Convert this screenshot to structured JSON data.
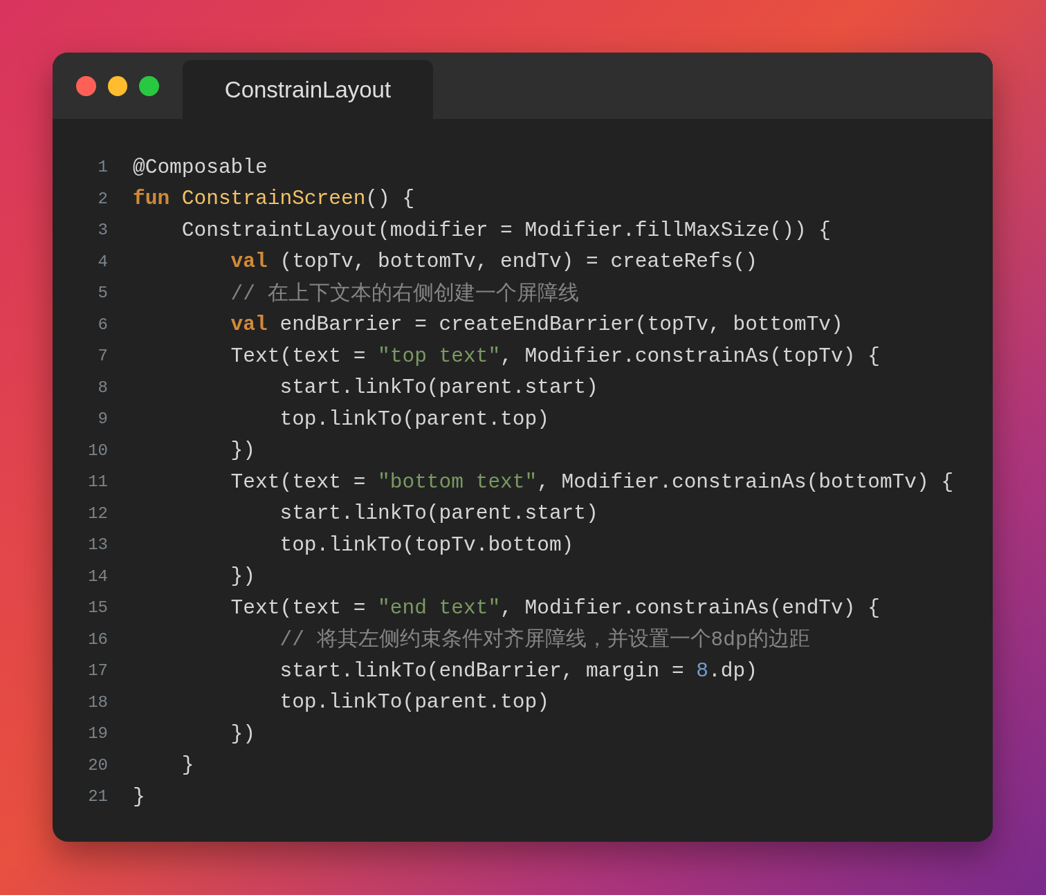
{
  "window": {
    "title": "ConstrainLayout"
  },
  "code": {
    "lines": [
      {
        "number": "1",
        "tokens": [
          {
            "kind": "plain",
            "text": "@Composable"
          }
        ]
      },
      {
        "number": "2",
        "tokens": [
          {
            "kind": "keyword",
            "text": "fun "
          },
          {
            "kind": "function",
            "text": "ConstrainScreen"
          },
          {
            "kind": "plain",
            "text": "() {"
          }
        ]
      },
      {
        "number": "3",
        "tokens": [
          {
            "kind": "plain",
            "text": "    ConstraintLayout(modifier = Modifier.fillMaxSize()) {"
          }
        ]
      },
      {
        "number": "4",
        "tokens": [
          {
            "kind": "keyword",
            "text": "        val"
          },
          {
            "kind": "plain",
            "text": " (topTv, bottomTv, endTv) = createRefs()"
          }
        ]
      },
      {
        "number": "5",
        "tokens": [
          {
            "kind": "comment",
            "text": "        // 在上下文本的右侧创建一个屏障线"
          }
        ]
      },
      {
        "number": "6",
        "tokens": [
          {
            "kind": "keyword",
            "text": "        val"
          },
          {
            "kind": "plain",
            "text": " endBarrier = createEndBarrier(topTv, bottomTv)"
          }
        ]
      },
      {
        "number": "7",
        "tokens": [
          {
            "kind": "plain",
            "text": "        Text(text = "
          },
          {
            "kind": "string",
            "text": "\"top text\""
          },
          {
            "kind": "plain",
            "text": ", Modifier.constrainAs(topTv) {"
          }
        ]
      },
      {
        "number": "8",
        "tokens": [
          {
            "kind": "plain",
            "text": "            start.linkTo(parent.start)"
          }
        ]
      },
      {
        "number": "9",
        "tokens": [
          {
            "kind": "plain",
            "text": "            top.linkTo(parent.top)"
          }
        ]
      },
      {
        "number": "10",
        "tokens": [
          {
            "kind": "plain",
            "text": "        })"
          }
        ]
      },
      {
        "number": "11",
        "tokens": [
          {
            "kind": "plain",
            "text": "        Text(text = "
          },
          {
            "kind": "string",
            "text": "\"bottom text\""
          },
          {
            "kind": "plain",
            "text": ", Modifier.constrainAs(bottomTv) {"
          }
        ]
      },
      {
        "number": "12",
        "tokens": [
          {
            "kind": "plain",
            "text": "            start.linkTo(parent.start)"
          }
        ]
      },
      {
        "number": "13",
        "tokens": [
          {
            "kind": "plain",
            "text": "            top.linkTo(topTv.bottom)"
          }
        ]
      },
      {
        "number": "14",
        "tokens": [
          {
            "kind": "plain",
            "text": "        })"
          }
        ]
      },
      {
        "number": "15",
        "tokens": [
          {
            "kind": "plain",
            "text": "        Text(text = "
          },
          {
            "kind": "string",
            "text": "\"end text\""
          },
          {
            "kind": "plain",
            "text": ", Modifier.constrainAs(endTv) {"
          }
        ]
      },
      {
        "number": "16",
        "tokens": [
          {
            "kind": "comment",
            "text": "            // 将其左侧约束条件对齐屏障线，并设置一个8dp的边距"
          }
        ]
      },
      {
        "number": "17",
        "tokens": [
          {
            "kind": "plain",
            "text": "            start.linkTo(endBarrier, margin = "
          },
          {
            "kind": "number",
            "text": "8"
          },
          {
            "kind": "plain",
            "text": ".dp)"
          }
        ]
      },
      {
        "number": "18",
        "tokens": [
          {
            "kind": "plain",
            "text": "            top.linkTo(parent.top)"
          }
        ]
      },
      {
        "number": "19",
        "tokens": [
          {
            "kind": "plain",
            "text": "        })"
          }
        ]
      },
      {
        "number": "20",
        "tokens": [
          {
            "kind": "plain",
            "text": "    }"
          }
        ]
      },
      {
        "number": "21",
        "tokens": [
          {
            "kind": "plain",
            "text": "}"
          }
        ]
      }
    ]
  }
}
